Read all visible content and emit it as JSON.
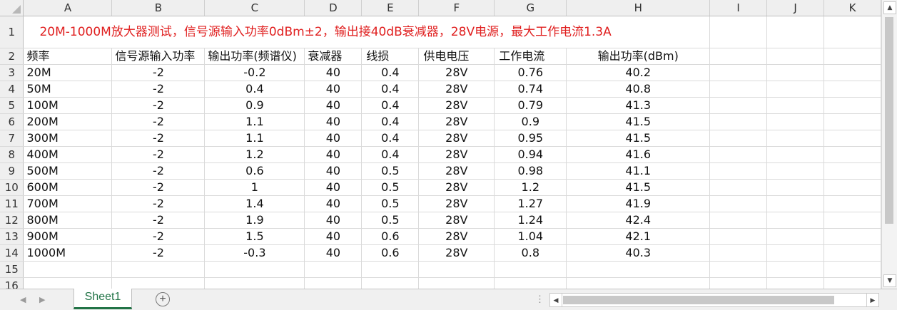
{
  "columns": [
    "A",
    "B",
    "C",
    "D",
    "E",
    "F",
    "G",
    "H",
    "I",
    "J",
    "K"
  ],
  "title": "20M-1000M放大器测试，信号源输入功率0dBm±2，输出接40dB衰减器，28V电源，最大工作电流1.3A",
  "headers": [
    "频率",
    "信号源输入功率",
    "输出功率(频谱仪)",
    "衰减器",
    "线损",
    "供电电压",
    "工作电流",
    "输出功率(dBm)"
  ],
  "rows": [
    [
      "20M",
      "-2",
      "-0.2",
      "40",
      "0.4",
      "28V",
      "0.76",
      "40.2"
    ],
    [
      "50M",
      "-2",
      "0.4",
      "40",
      "0.4",
      "28V",
      "0.74",
      "40.8"
    ],
    [
      "100M",
      "-2",
      "0.9",
      "40",
      "0.4",
      "28V",
      "0.79",
      "41.3"
    ],
    [
      "200M",
      "-2",
      "1.1",
      "40",
      "0.4",
      "28V",
      "0.9",
      "41.5"
    ],
    [
      "300M",
      "-2",
      "1.1",
      "40",
      "0.4",
      "28V",
      "0.95",
      "41.5"
    ],
    [
      "400M",
      "-2",
      "1.2",
      "40",
      "0.4",
      "28V",
      "0.94",
      "41.6"
    ],
    [
      "500M",
      "-2",
      "0.6",
      "40",
      "0.5",
      "28V",
      "0.98",
      "41.1"
    ],
    [
      "600M",
      "-2",
      "1",
      "40",
      "0.5",
      "28V",
      "1.2",
      "41.5"
    ],
    [
      "700M",
      "-2",
      "1.4",
      "40",
      "0.5",
      "28V",
      "1.27",
      "41.9"
    ],
    [
      "800M",
      "-2",
      "1.9",
      "40",
      "0.5",
      "28V",
      "1.24",
      "42.4"
    ],
    [
      "900M",
      "-2",
      "1.5",
      "40",
      "0.6",
      "28V",
      "1.04",
      "42.1"
    ],
    [
      "1000M",
      "-2",
      "-0.3",
      "40",
      "0.6",
      "28V",
      "0.8",
      "40.3"
    ]
  ],
  "row_numbers": [
    "1",
    "2",
    "3",
    "4",
    "5",
    "6",
    "7",
    "8",
    "9",
    "10",
    "11",
    "12",
    "13",
    "14",
    "15",
    "16"
  ],
  "sheet_tab": "Sheet1",
  "add_sheet_symbol": "+",
  "colors": {
    "title": "#e02020",
    "tab_accent": "#217346"
  }
}
